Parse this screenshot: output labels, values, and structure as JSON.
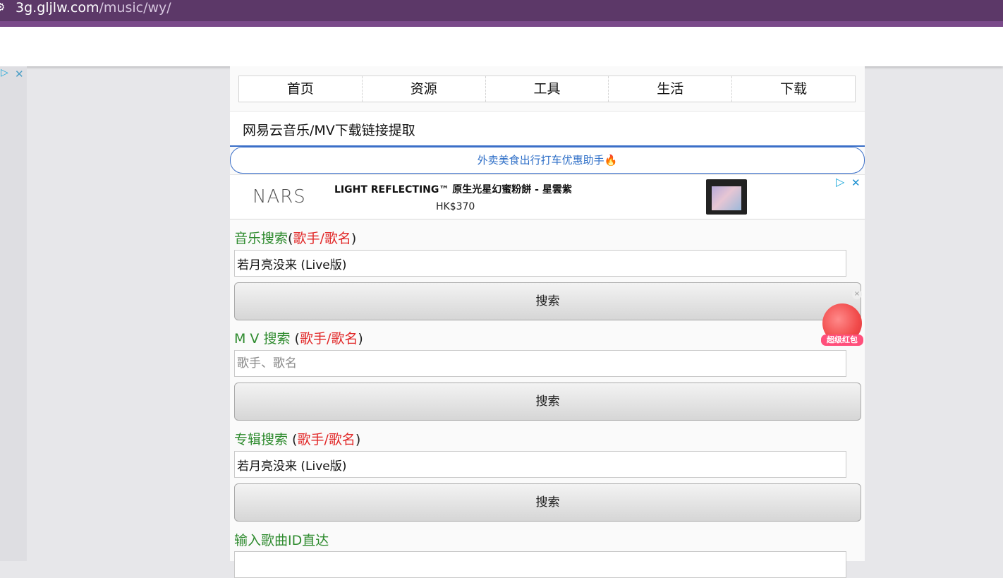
{
  "browser": {
    "url_host": "3g.gljlw.com",
    "url_path": "/music/wy/"
  },
  "nav": [
    "首页",
    "资源",
    "工具",
    "生活",
    "下载"
  ],
  "page_title": "网易云音乐/MV下载链接提取",
  "promo": {
    "text": "外卖美食出行打车优惠助手",
    "emoji": "🔥"
  },
  "ad": {
    "brand": "NARS",
    "title": "LIGHT REFLECTING™ 原生光星幻蜜粉餅 - 星雲紫",
    "price": "HK$370",
    "choice_icon": "▷",
    "close_icon": "✕"
  },
  "music_search": {
    "label": "音乐搜索",
    "paren_open": "(",
    "hint": "歌手/歌名",
    "paren_close": ")",
    "value": "若月亮没来 (Live版)",
    "button": "搜索"
  },
  "mv_search": {
    "label": "M V 搜索 ",
    "paren_open": "(",
    "hint": "歌手/歌名",
    "paren_close": ")",
    "placeholder": "歌手、歌名",
    "button": "搜索"
  },
  "album_search": {
    "label": "专辑搜索 ",
    "paren_open": "(",
    "hint": "歌手/歌名",
    "paren_close": ")",
    "value": "若月亮没来 (Live版)",
    "button": "搜索"
  },
  "id_search": {
    "label": "输入歌曲ID直达"
  },
  "red_packet": {
    "label": "超级红包"
  }
}
